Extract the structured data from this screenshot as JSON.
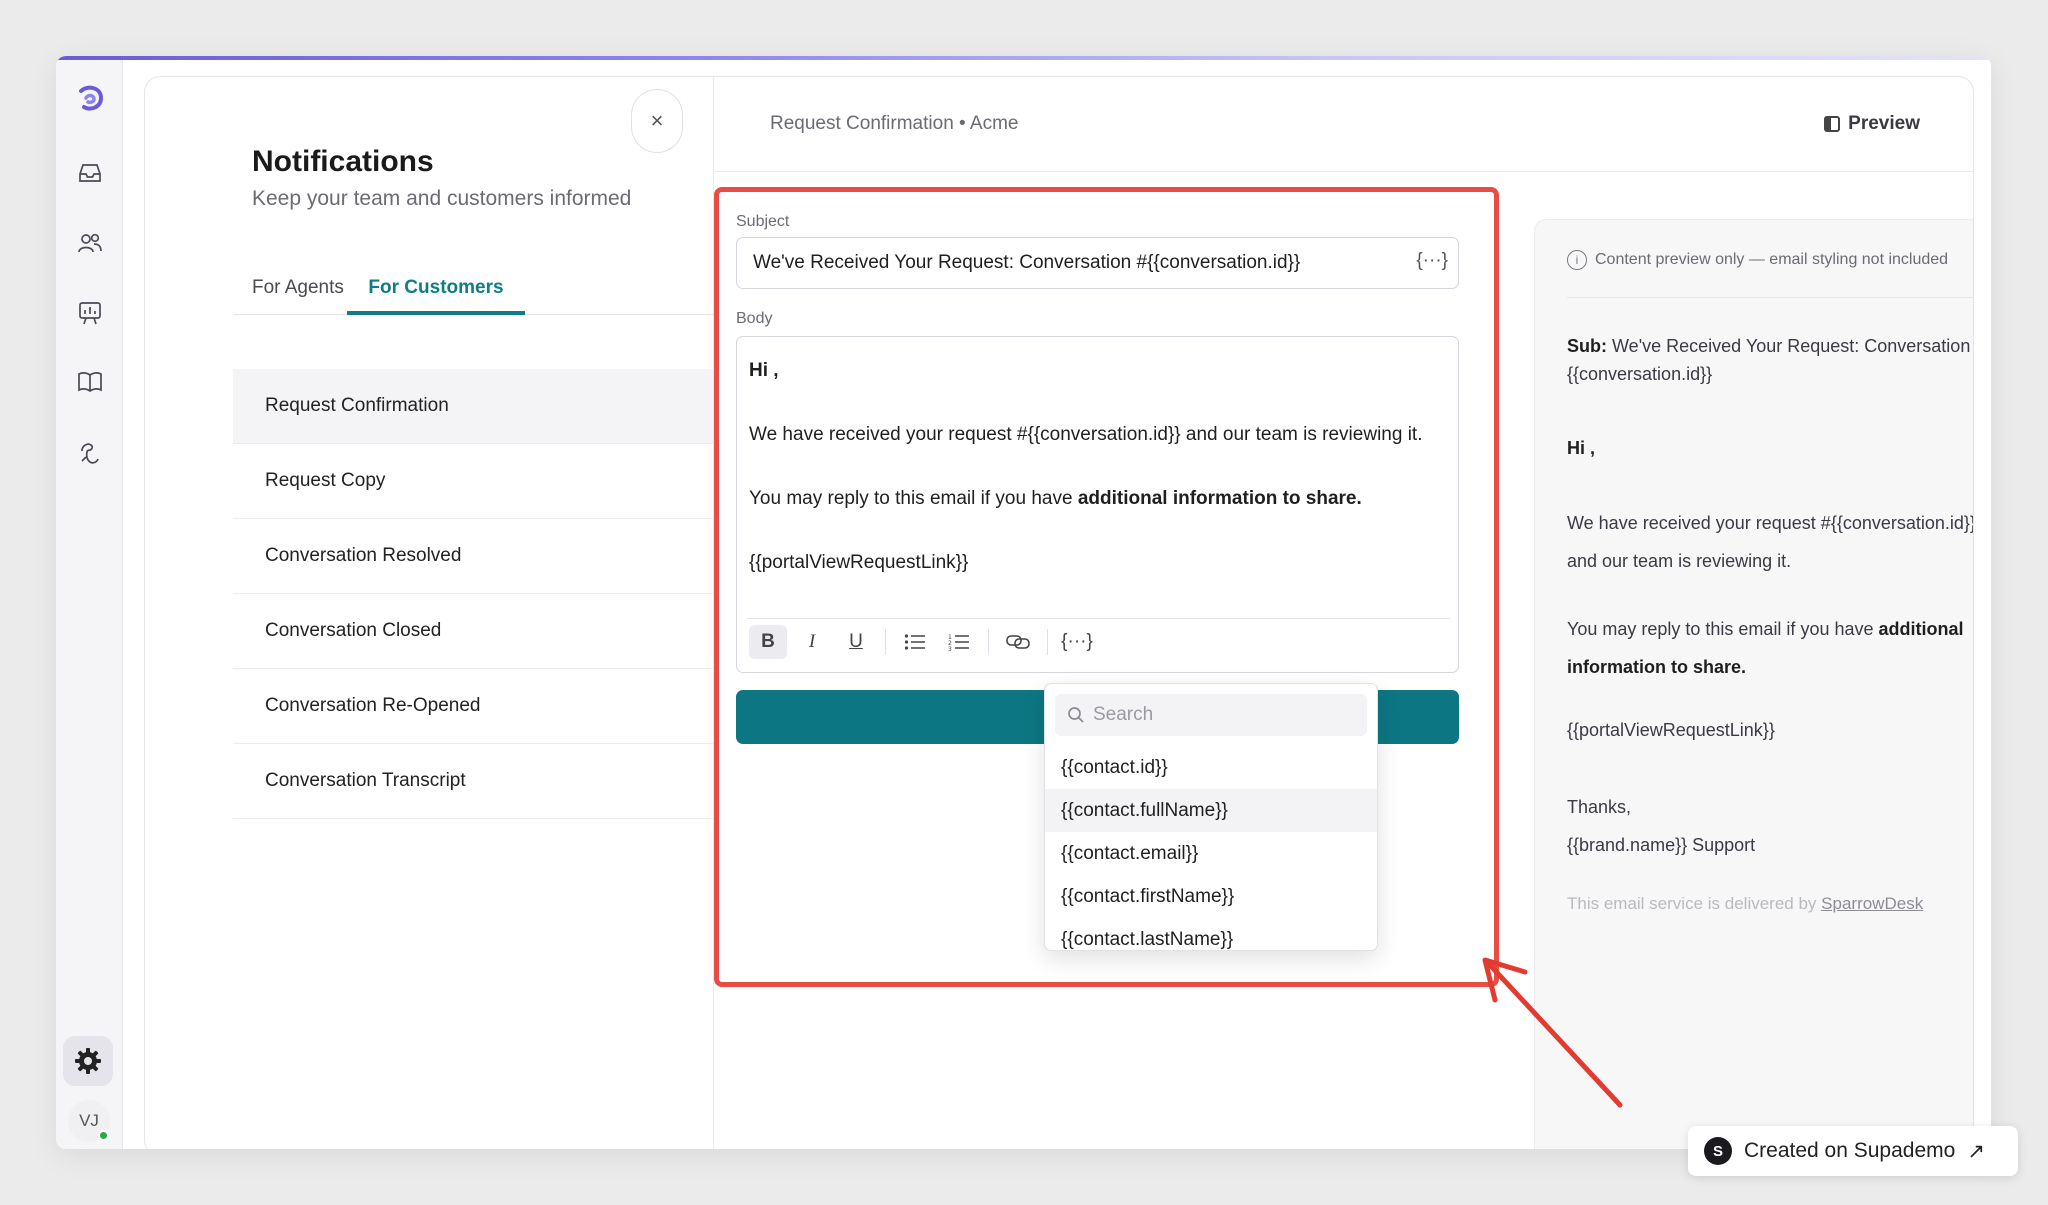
{
  "sidebar": {
    "icons": [
      "logo-icon",
      "inbox-icon",
      "users-icon",
      "reports-icon",
      "knowledge-base-icon",
      "automation-icon",
      "gear-icon"
    ],
    "avatar_initials": "VJ"
  },
  "notifications": {
    "title": "Notifications",
    "subtitle": "Keep your team and customers informed",
    "tabs": [
      {
        "label": "For Agents",
        "active": false
      },
      {
        "label": "For Customers",
        "active": true
      }
    ],
    "items": [
      {
        "label": "Request Confirmation",
        "active": true
      },
      {
        "label": "Request Copy"
      },
      {
        "label": "Conversation Resolved"
      },
      {
        "label": "Conversation Closed"
      },
      {
        "label": "Conversation Re-Opened"
      },
      {
        "label": "Conversation Transcript"
      }
    ]
  },
  "editor": {
    "close_label": "×",
    "title": "Request Confirmation • Acme",
    "preview_label": "Preview",
    "subject_label": "Subject",
    "subject_value": "We've Received Your Request: Conversation #{{conversation.id}}",
    "variable_button": "{···}",
    "body_label": "Body",
    "body": {
      "greeting": "Hi ,",
      "line1": "We have received your request #{{conversation.id}} and our team is reviewing it.",
      "line2_plain": "You may reply to this email if you have ",
      "line2_bold": "additional information to share.",
      "link": "{{portalViewRequestLink}}"
    },
    "toolbar": [
      "bold",
      "italic",
      "underline",
      "bulleted-list",
      "numbered-list",
      "link",
      "variable"
    ],
    "dropdown": {
      "search_placeholder": "Search",
      "items": [
        "{{contact.id}}",
        "{{contact.fullName}}",
        "{{contact.email}}",
        "{{contact.firstName}}",
        "{{contact.lastName}}"
      ],
      "highlighted_index": 1
    }
  },
  "preview": {
    "note": "Content preview only — email styling not included",
    "sub_label": "Sub:",
    "subject": "We've Received Your Request: Conversation #{{conversation.id}}",
    "greeting": "Hi ,",
    "line1": "We have received your request #{{conversation.id}} and our team is reviewing it.",
    "line2_plain": "You may reply to this email if you have ",
    "line2_bold": "additional information to share.",
    "link": "{{portalViewRequestLink}}",
    "thanks": "Thanks,",
    "signature": "{{brand.name}} Support",
    "footer_text": "This email service is delivered by ",
    "footer_link": "SparrowDesk"
  },
  "badge": {
    "logo_letter": "S",
    "label": "Created on Supademo",
    "arrow": "↗"
  },
  "colors": {
    "accent": "#0f7c86",
    "highlight": "#e74c45",
    "save_bar": "#0c7782"
  }
}
